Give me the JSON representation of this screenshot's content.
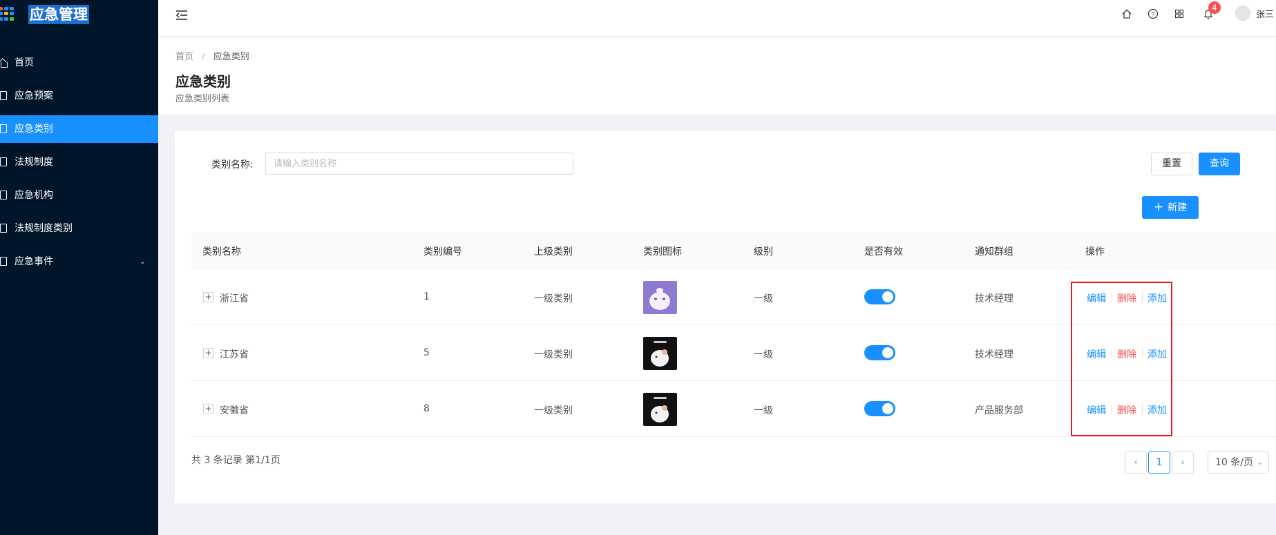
{
  "app": {
    "title": "应急管理"
  },
  "sidebar": {
    "items": [
      {
        "label": "首页",
        "active": false
      },
      {
        "label": "应急预案",
        "active": false
      },
      {
        "label": "应急类别",
        "active": true
      },
      {
        "label": "法规制度",
        "active": false
      },
      {
        "label": "应急机构",
        "active": false
      },
      {
        "label": "法规制度类别",
        "active": false
      },
      {
        "label": "应急事件",
        "active": false,
        "has_children": true
      }
    ]
  },
  "header": {
    "notification_count": "4",
    "user_name": "张三"
  },
  "breadcrumb": {
    "home": "首页",
    "separator": "/",
    "current": "应急类别"
  },
  "page": {
    "title": "应急类别",
    "subtitle": "应急类别列表"
  },
  "search": {
    "label": "类别名称:",
    "placeholder": "请输入类别名称",
    "value": "",
    "reset_label": "重置",
    "query_label": "查询",
    "new_label": "新建"
  },
  "table": {
    "columns": [
      "类别名称",
      "类别编号",
      "上级类别",
      "类别图标",
      "级别",
      "是否有效",
      "通知群组",
      "操作"
    ],
    "rows": [
      {
        "name": "浙江省",
        "code": "1",
        "parent": "一级类别",
        "icon": "purple-cat-image",
        "level": "一级",
        "valid": true,
        "group": "技术经理"
      },
      {
        "name": "江苏省",
        "code": "5",
        "parent": "一级类别",
        "icon": "dark-bunny-image",
        "level": "一级",
        "valid": true,
        "group": "技术经理"
      },
      {
        "name": "安徽省",
        "code": "8",
        "parent": "一级类别",
        "icon": "dark-bunny-image",
        "level": "一级",
        "valid": true,
        "group": "产品服务部"
      }
    ],
    "actions": {
      "edit": "编辑",
      "delete": "删除",
      "add": "添加"
    }
  },
  "pagination": {
    "summary": "共 3 条记录 第1/1页",
    "current_page": "1",
    "page_size": "10 条/页"
  },
  "colors": {
    "primary": "#1890ff",
    "danger": "#ff4d4f",
    "sidebar": "#001529",
    "highlight_box": "#e81919"
  }
}
